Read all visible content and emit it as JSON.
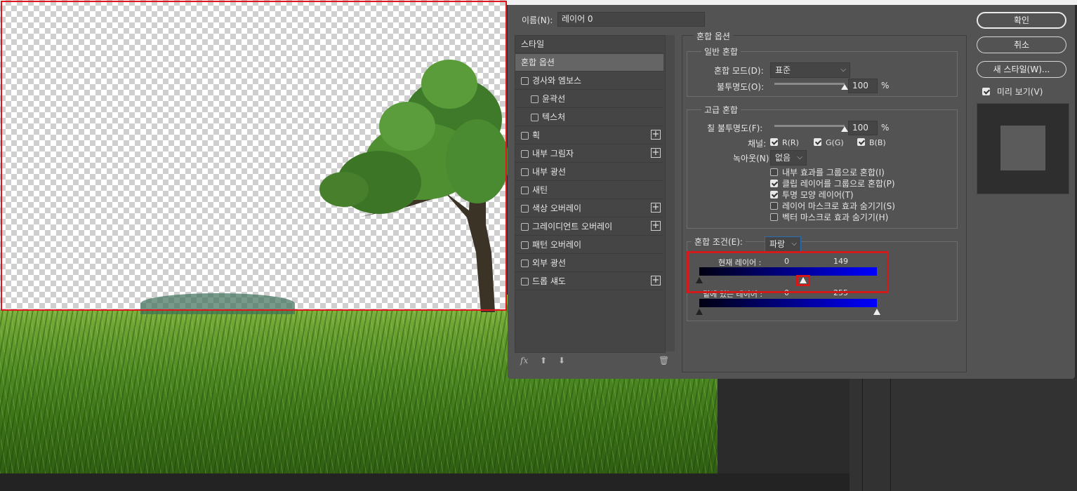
{
  "dialog": {
    "name_label": "이름(N):",
    "name_value": "레이어 0",
    "buttons": {
      "ok": "확인",
      "cancel": "취소",
      "new_style": "새 스타일(W)..."
    },
    "preview": {
      "label": "미리 보기(V)",
      "checked": true
    }
  },
  "styles": {
    "items": [
      {
        "label": "스타일",
        "checkbox": false,
        "checked": false,
        "selected": false,
        "plus": false,
        "indent": 0
      },
      {
        "label": "혼합 옵션",
        "checkbox": false,
        "checked": false,
        "selected": true,
        "plus": false,
        "indent": 0
      },
      {
        "label": "경사와 엠보스",
        "checkbox": true,
        "checked": false,
        "selected": false,
        "plus": false,
        "indent": 0
      },
      {
        "label": "윤곽선",
        "checkbox": true,
        "checked": false,
        "selected": false,
        "plus": false,
        "indent": 1
      },
      {
        "label": "텍스처",
        "checkbox": true,
        "checked": false,
        "selected": false,
        "plus": false,
        "indent": 1
      },
      {
        "label": "획",
        "checkbox": true,
        "checked": false,
        "selected": false,
        "plus": true,
        "indent": 0
      },
      {
        "label": "내부 그림자",
        "checkbox": true,
        "checked": false,
        "selected": false,
        "plus": true,
        "indent": 0
      },
      {
        "label": "내부 광선",
        "checkbox": true,
        "checked": false,
        "selected": false,
        "plus": false,
        "indent": 0
      },
      {
        "label": "새틴",
        "checkbox": true,
        "checked": false,
        "selected": false,
        "plus": false,
        "indent": 0
      },
      {
        "label": "색상 오버레이",
        "checkbox": true,
        "checked": false,
        "selected": false,
        "plus": true,
        "indent": 0
      },
      {
        "label": "그레이디언트 오버레이",
        "checkbox": true,
        "checked": false,
        "selected": false,
        "plus": true,
        "indent": 0
      },
      {
        "label": "패턴 오버레이",
        "checkbox": true,
        "checked": false,
        "selected": false,
        "plus": false,
        "indent": 0
      },
      {
        "label": "외부 광선",
        "checkbox": true,
        "checked": false,
        "selected": false,
        "plus": false,
        "indent": 0
      },
      {
        "label": "드롭 섀도",
        "checkbox": true,
        "checked": false,
        "selected": false,
        "plus": true,
        "indent": 0
      }
    ],
    "footer": {
      "fx": "fx",
      "up_icon": "arrow-up-icon",
      "down_icon": "arrow-down-icon",
      "delete_icon": "trash-icon"
    }
  },
  "blending": {
    "title": "혼합 옵션",
    "general": {
      "title": "일반 혼합",
      "mode_label": "혼합 모드(D):",
      "mode_value": "표준",
      "opacity_label": "불투명도(O):",
      "opacity_value": "100",
      "opacity_level": 1.0,
      "unit": "%"
    },
    "advanced": {
      "title": "고급 혼합",
      "fill_label": "칠 불투명도(F):",
      "fill_value": "100",
      "fill_level": 1.0,
      "unit": "%",
      "channels_label": "채널:",
      "channels": [
        {
          "label": "R(R)",
          "checked": true
        },
        {
          "label": "G(G)",
          "checked": true
        },
        {
          "label": "B(B)",
          "checked": true
        }
      ],
      "knockout_label": "녹아웃(N):",
      "knockout_value": "없음",
      "options": [
        {
          "label": "내부 효과를 그룹으로 혼합(I)",
          "checked": false
        },
        {
          "label": "클립 레이어를 그룹으로 혼합(P)",
          "checked": true
        },
        {
          "label": "투명 모양 레이어(T)",
          "checked": true
        },
        {
          "label": "레이어 마스크로 효과 숨기기(S)",
          "checked": false
        },
        {
          "label": "벡터 마스크로 효과 숨기기(H)",
          "checked": false
        }
      ]
    },
    "blend_if": {
      "label": "혼합 조건(E):",
      "channel": "파랑",
      "this_layer": {
        "label": "현재 레이어 :",
        "low": "0",
        "high": "149",
        "low_value": 0,
        "high_value": 149
      },
      "underlying": {
        "label": "밑에 있는 레이어 :",
        "low": "0",
        "high": "255",
        "low_value": 0,
        "high_value": 255
      },
      "max": 255
    }
  }
}
